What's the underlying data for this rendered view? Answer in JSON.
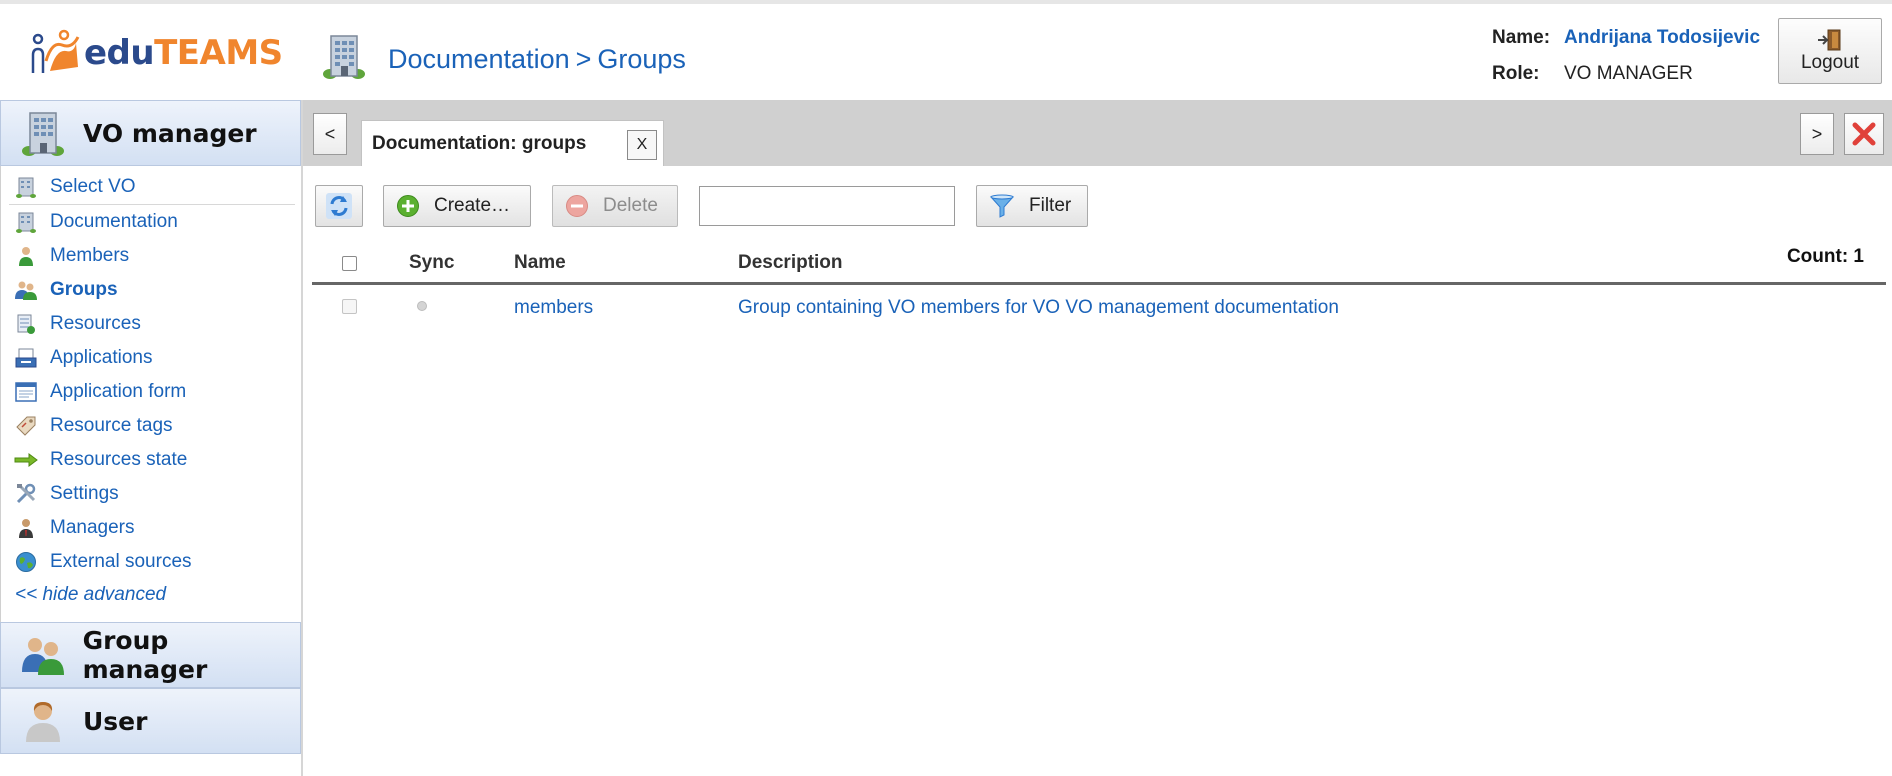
{
  "header": {
    "logo": {
      "part1": "edu",
      "part2": "TEAMS"
    },
    "breadcrumb": {
      "first": "Documentation",
      "separator": ">",
      "second": "Groups"
    },
    "user": {
      "name_label": "Name:",
      "name_value": "Andrijana Todosijevic",
      "role_label": "Role:",
      "role_value": "VO MANAGER"
    },
    "logout_label": "Logout"
  },
  "sidebar": {
    "vo_manager_title": "VO manager",
    "items": [
      {
        "label": "Select VO",
        "icon": "building-icon"
      },
      {
        "label": "Documentation",
        "icon": "building-icon"
      },
      {
        "label": "Members",
        "icon": "member-icon"
      },
      {
        "label": "Groups",
        "icon": "group-icon",
        "active": true
      },
      {
        "label": "Resources",
        "icon": "resources-icon"
      },
      {
        "label": "Applications",
        "icon": "applications-icon"
      },
      {
        "label": "Application form",
        "icon": "form-icon"
      },
      {
        "label": "Resource tags",
        "icon": "tag-icon"
      },
      {
        "label": "Resources state",
        "icon": "arrow-right-icon"
      },
      {
        "label": "Settings",
        "icon": "tools-icon"
      },
      {
        "label": "Managers",
        "icon": "manager-icon"
      },
      {
        "label": "External sources",
        "icon": "globe-icon"
      }
    ],
    "hide_advanced": "<< hide advanced",
    "group_manager_title": "Group manager",
    "user_title": "User"
  },
  "tabs": {
    "prev_label": "<",
    "next_label": ">",
    "active_tab": {
      "label": "Documentation: groups",
      "close_label": "X"
    }
  },
  "toolbar": {
    "create_label": "Create…",
    "delete_label": "Delete",
    "filter_value": "",
    "filter_label": "Filter"
  },
  "table": {
    "columns": {
      "sync": "Sync",
      "name": "Name",
      "description": "Description"
    },
    "count_text": "Count: 1",
    "rows": [
      {
        "name": "members",
        "description": "Group containing VO members for VO VO management documentation"
      }
    ]
  },
  "colors": {
    "link": "#1a62b8",
    "accent_orange": "#f0852d",
    "logo_blue": "#2b4a8c",
    "sidebar_header": "#d3e0f3",
    "tabbar": "#d0d0d0"
  }
}
